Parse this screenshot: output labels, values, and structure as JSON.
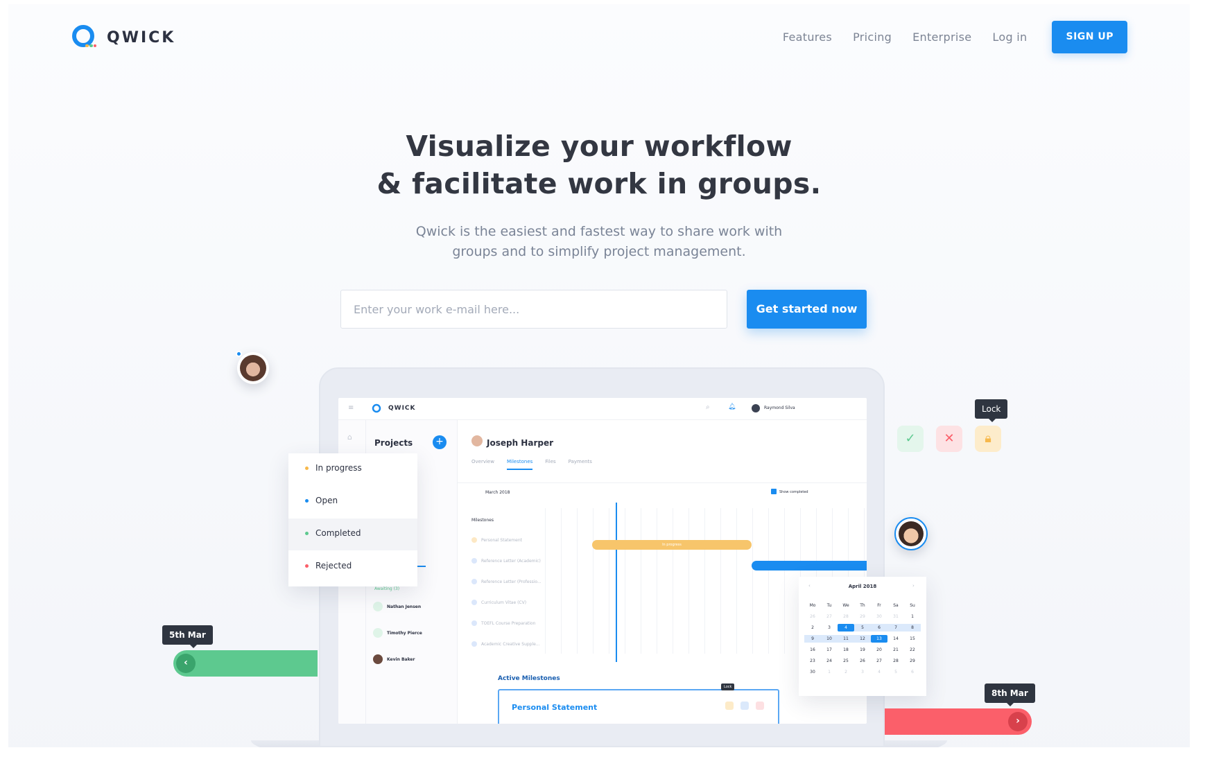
{
  "brand": {
    "name": "QWICK"
  },
  "nav": {
    "links": [
      "Features",
      "Pricing",
      "Enterprise",
      "Log in"
    ],
    "signup_label": "SIGN UP"
  },
  "hero": {
    "title_line1": "Visualize your workflow",
    "title_line2": "& facilitate work in groups.",
    "subtitle_line1": "Qwick is the easiest and fastest way to share work with",
    "subtitle_line2": "groups and to simplify project management.",
    "email_placeholder": "Enter your work e-mail here...",
    "cta_label": "Get started now"
  },
  "app": {
    "brand": "QWICK",
    "user": "Raymond Silva",
    "projects_title": "Projects",
    "person": "Joseph Harper",
    "tabs": [
      "Overview",
      "Milestones",
      "Files",
      "Payments"
    ],
    "month": "March 2018",
    "show_completed": "Show completed",
    "milestones_label": "Milestones",
    "milestone_rows": [
      "Personal Statement",
      "Reference Letter (Academic)",
      "Reference Letter (Professio...",
      "Curriculum Vitae (CV)",
      "TOEFL Course Preparation",
      "Academic Creative Supple..."
    ],
    "in_progress_bar": "In progress",
    "awaiting": "Awaiting (3)",
    "people": [
      "Nathan Jensen",
      "Timothy Pierce",
      "Kevin Baker"
    ],
    "active_milestones": "Active Milestones",
    "card_title": "Personal Statement",
    "card_lock": "Lock"
  },
  "status_menu": [
    {
      "label": "In progress",
      "color": "#f7b84b"
    },
    {
      "label": "Open",
      "color": "#1a8cf0"
    },
    {
      "label": "Completed",
      "color": "#5dc98f"
    },
    {
      "label": "Rejected",
      "color": "#fb5f6a"
    }
  ],
  "tooltips": {
    "lock": "Lock",
    "start": "5th Mar",
    "end": "8th Mar"
  },
  "calendar": {
    "title": "April 2018",
    "weekdays": [
      "Mo",
      "Tu",
      "We",
      "Th",
      "Fr",
      "Sa",
      "Su"
    ]
  },
  "colors": {
    "accent": "#1a8cf0",
    "green": "#5dc98f",
    "red": "#fb5f6a",
    "orange": "#f7b84b"
  }
}
